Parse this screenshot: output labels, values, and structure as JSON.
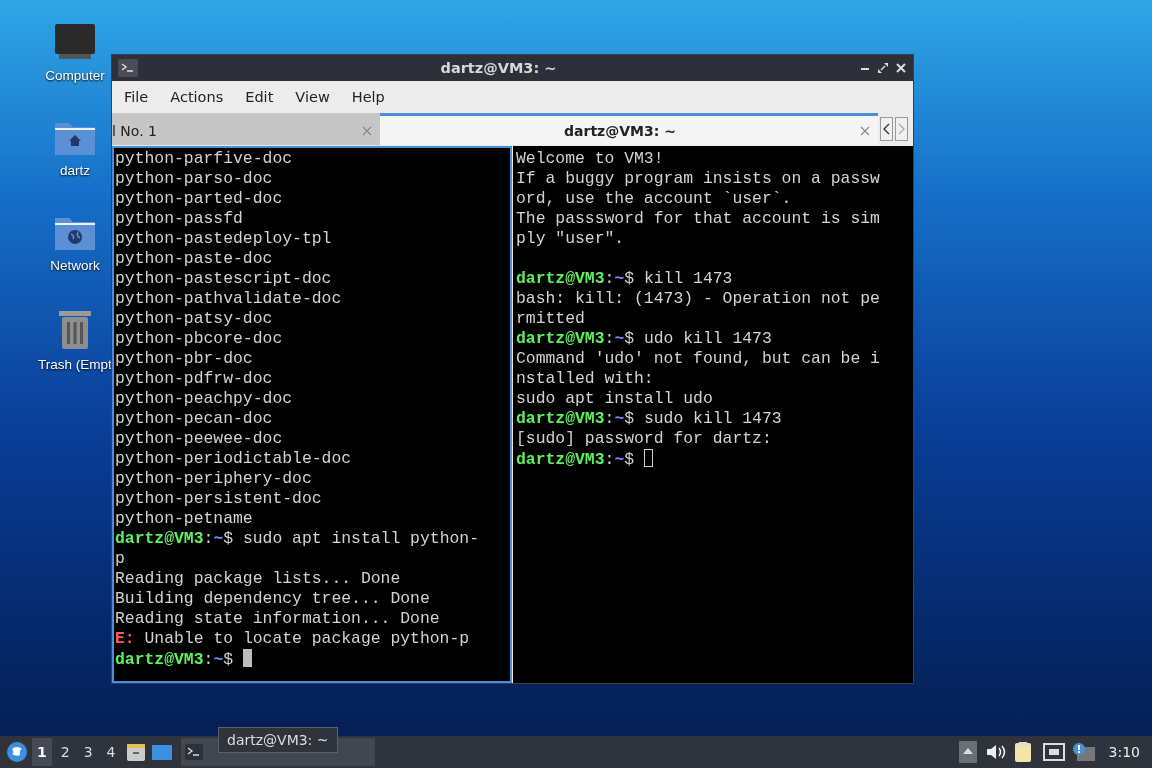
{
  "desktop_icons": [
    {
      "kind": "computer",
      "label": "Computer"
    },
    {
      "kind": "home",
      "label": "dartz"
    },
    {
      "kind": "network",
      "label": "Network"
    },
    {
      "kind": "trash",
      "label": "Trash (Empt"
    }
  ],
  "window": {
    "title": "dartz@VM3: ~",
    "menu": [
      "File",
      "Actions",
      "Edit",
      "View",
      "Help"
    ],
    "tabs": [
      {
        "label": "l No. 1",
        "selected": false
      },
      {
        "label": "dartz@VM3: ~",
        "selected": true
      }
    ],
    "panes": [
      {
        "focused": true,
        "lines": [
          {
            "kind": "plain",
            "text": "python-parfive-doc"
          },
          {
            "kind": "plain",
            "text": "python-parso-doc"
          },
          {
            "kind": "plain",
            "text": "python-parted-doc"
          },
          {
            "kind": "plain",
            "text": "python-passfd"
          },
          {
            "kind": "plain",
            "text": "python-pastedeploy-tpl"
          },
          {
            "kind": "plain",
            "text": "python-paste-doc"
          },
          {
            "kind": "plain",
            "text": "python-pastescript-doc"
          },
          {
            "kind": "plain",
            "text": "python-pathvalidate-doc"
          },
          {
            "kind": "plain",
            "text": "python-patsy-doc"
          },
          {
            "kind": "plain",
            "text": "python-pbcore-doc"
          },
          {
            "kind": "plain",
            "text": "python-pbr-doc"
          },
          {
            "kind": "plain",
            "text": "python-pdfrw-doc"
          },
          {
            "kind": "plain",
            "text": "python-peachpy-doc"
          },
          {
            "kind": "plain",
            "text": "python-pecan-doc"
          },
          {
            "kind": "plain",
            "text": "python-peewee-doc"
          },
          {
            "kind": "plain",
            "text": "python-periodictable-doc"
          },
          {
            "kind": "plain",
            "text": "python-periphery-doc"
          },
          {
            "kind": "plain",
            "text": "python-persistent-doc"
          },
          {
            "kind": "plain",
            "text": "python-petname"
          },
          {
            "kind": "prompt",
            "user": "dartz@VM3",
            "sep": ":",
            "path": "~",
            "sigil": "$",
            "command": "sudo apt install python-"
          },
          {
            "kind": "plain",
            "text": "p"
          },
          {
            "kind": "plain",
            "text": "Reading package lists... Done"
          },
          {
            "kind": "plain",
            "text": "Building dependency tree... Done"
          },
          {
            "kind": "plain",
            "text": "Reading state information... Done"
          },
          {
            "kind": "error",
            "prefix": "E:",
            "text": "Unable to locate package python-p"
          },
          {
            "kind": "prompt",
            "user": "dartz@VM3",
            "sep": ":",
            "path": "~",
            "sigil": "$",
            "cursor": true
          }
        ]
      },
      {
        "focused": false,
        "lines": [
          {
            "kind": "plain",
            "text": "Welcome to VM3!"
          },
          {
            "kind": "plain",
            "text": "If a buggy program insists on a passw"
          },
          {
            "kind": "plain",
            "text": "ord, use the account `user`."
          },
          {
            "kind": "plain",
            "text": "The passsword for that account is sim"
          },
          {
            "kind": "plain",
            "text": "ply \"user\"."
          },
          {
            "kind": "blank"
          },
          {
            "kind": "prompt",
            "user": "dartz@VM3",
            "sep": ":",
            "path": "~",
            "sigil": "$",
            "command": "kill 1473"
          },
          {
            "kind": "plain",
            "text": "bash: kill: (1473) - Operation not pe"
          },
          {
            "kind": "plain",
            "text": "rmitted"
          },
          {
            "kind": "prompt",
            "user": "dartz@VM3",
            "sep": ":",
            "path": "~",
            "sigil": "$",
            "command": "udo kill 1473"
          },
          {
            "kind": "plain",
            "text": "Command 'udo' not found, but can be i"
          },
          {
            "kind": "plain",
            "text": "nstalled with:"
          },
          {
            "kind": "plain",
            "text": "sudo apt install udo"
          },
          {
            "kind": "prompt",
            "user": "dartz@VM3",
            "sep": ":",
            "path": "~",
            "sigil": "$",
            "command": "sudo kill 1473"
          },
          {
            "kind": "plain",
            "text": "[sudo] password for dartz:"
          },
          {
            "kind": "prompt",
            "user": "dartz@VM3",
            "sep": ":",
            "path": "~",
            "sigil": "$",
            "cursor": true
          }
        ]
      }
    ]
  },
  "taskbar": {
    "workspaces": [
      {
        "label": "1",
        "selected": true
      },
      {
        "label": "2",
        "selected": false
      },
      {
        "label": "3",
        "selected": false
      },
      {
        "label": "4",
        "selected": false
      }
    ],
    "task": {
      "tooltip": "dartz@VM3: ~"
    },
    "clock": "3:10"
  }
}
